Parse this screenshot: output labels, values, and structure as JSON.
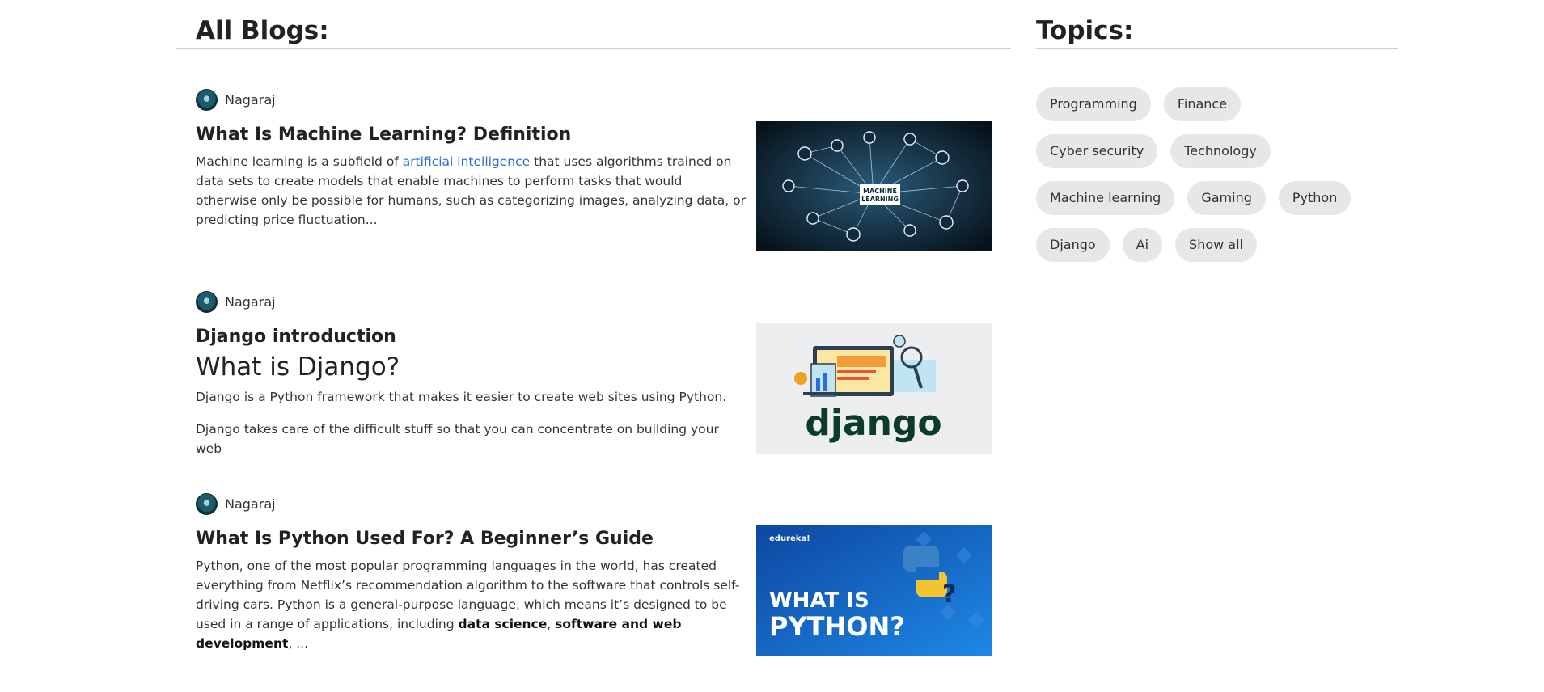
{
  "main": {
    "heading": "All Blogs:",
    "posts": [
      {
        "author": "Nagaraj",
        "title": "What Is Machine Learning? Definition",
        "body_pre": "Machine learning is a subfield of ",
        "body_link": "artificial intelligence",
        "body_post": " that uses algorithms trained on data sets to create models that enable machines to perform tasks that would otherwise only be possible for humans, such as categorizing images, analyzing data, or predicting price fluctuation...",
        "thumb_text": "MACHINE LEARNING"
      },
      {
        "author": "Nagaraj",
        "title": "Django introduction",
        "subtitle": "What is Django?",
        "para1": "Django is a Python framework that makes it easier to create web sites using Python.",
        "para2": "Django takes care of the difficult stuff so that you can concentrate on building your web",
        "thumb_text": "django"
      },
      {
        "author": "Nagaraj",
        "title": "What Is Python Used For? A Beginner’s Guide",
        "body_pre": "Python, one of the most popular programming languages in the world, has created everything from Netflix’s recommendation algorithm to the software that controls self-driving cars. Python is a general-purpose language, which means it’s designed to be used in a range of applications, including ",
        "bold1": "data science",
        "sep": ", ",
        "bold2": "software and web development",
        "body_post": ", ...",
        "thumb_brand": "edureka!",
        "thumb_line1": "WHAT IS",
        "thumb_line2": "PYTHON?"
      }
    ]
  },
  "sidebar": {
    "heading": "Topics:",
    "topics": [
      "Programming",
      "Finance",
      "Cyber security",
      "Technology",
      "Machine learning",
      "Gaming",
      "Python",
      "Django",
      "Ai",
      "Show all"
    ]
  },
  "colors": {
    "accent_link": "#2a6fd6",
    "topic_bg": "#e7e7e7",
    "ml_bg": "#0f2a3b",
    "python_bg": "#1565c0"
  }
}
